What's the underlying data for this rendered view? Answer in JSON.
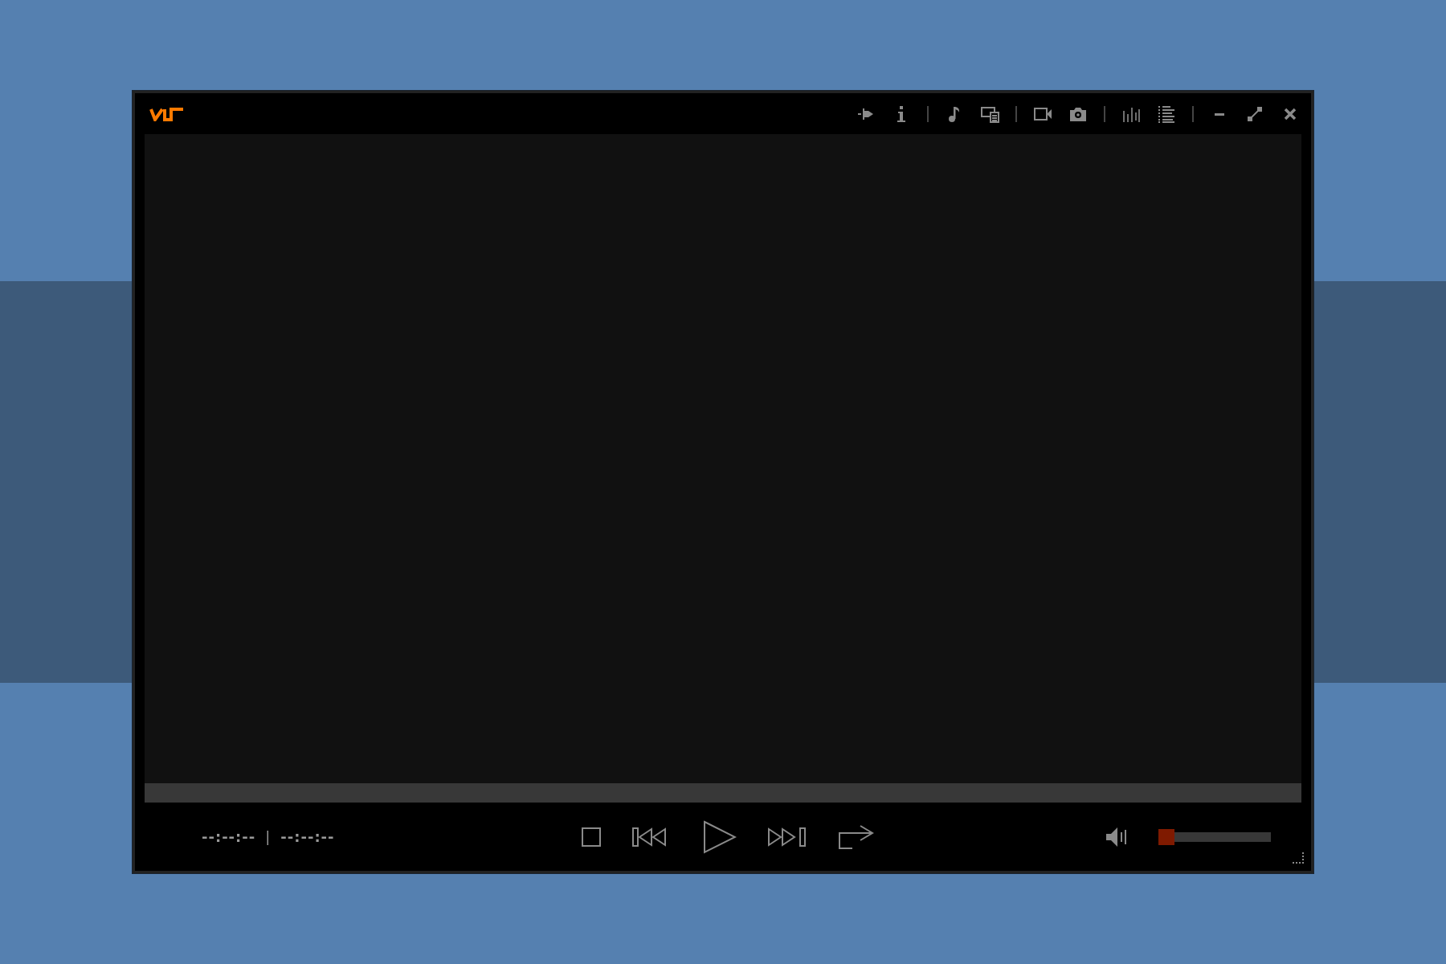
{
  "time": {
    "elapsed": "--:--:--",
    "separator": "|",
    "total": "--:--:--"
  },
  "volume": {
    "level": 0
  }
}
